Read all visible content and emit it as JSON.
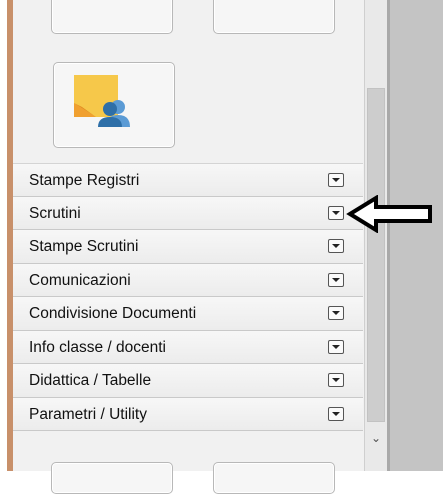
{
  "menu": {
    "items": [
      {
        "label": "Stampe Registri"
      },
      {
        "label": "Scrutini"
      },
      {
        "label": "Stampe Scrutini"
      },
      {
        "label": "Comunicazioni"
      },
      {
        "label": "Condivisione Documenti"
      },
      {
        "label": "Info classe / docenti"
      },
      {
        "label": "Didattica / Tabelle"
      },
      {
        "label": "Parametri / Utility"
      }
    ]
  },
  "icons": {
    "main_tile": "sticky-note-users-icon",
    "dropdown": "dropdown-arrow-icon",
    "annotation": "left-arrow-annotation-icon"
  },
  "colors": {
    "left_stripe": "#c8906a",
    "panel": "#f1f1f1",
    "note_yellow": "#f6c84a",
    "note_orange": "#f0a030",
    "users_blue": "#2e6fa8"
  }
}
